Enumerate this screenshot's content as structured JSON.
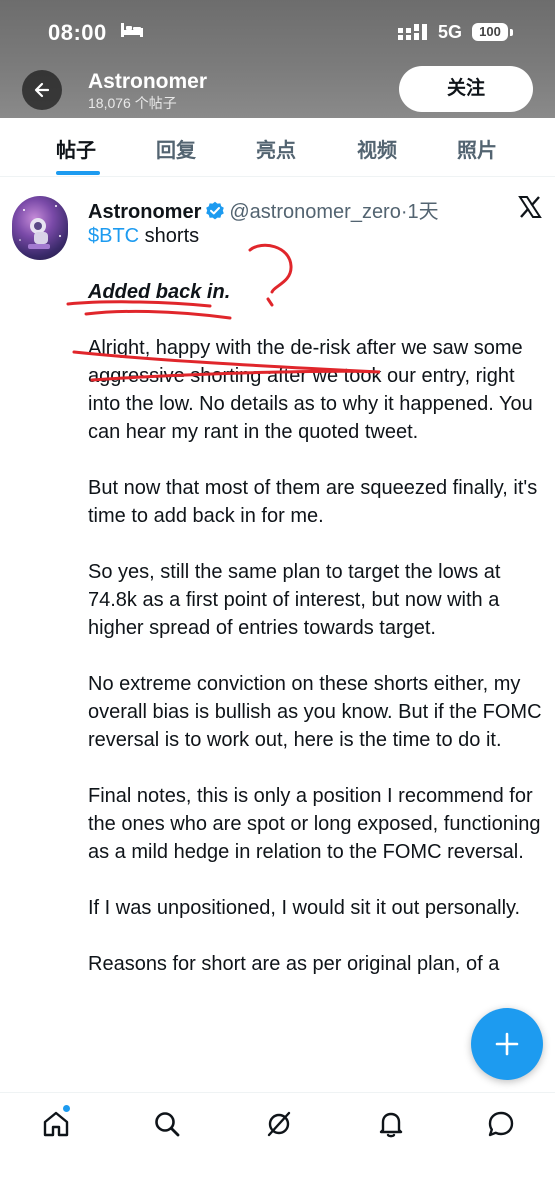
{
  "status_bar": {
    "time": "08:00",
    "network": "5G",
    "battery": "100"
  },
  "header": {
    "name": "Astronomer",
    "post_count": "18,076 个帖子",
    "follow_label": "关注"
  },
  "tabs": [
    {
      "label": "帖子",
      "active": true
    },
    {
      "label": "回复",
      "active": false
    },
    {
      "label": "亮点",
      "active": false
    },
    {
      "label": "视频",
      "active": false
    },
    {
      "label": "照片",
      "active": false
    }
  ],
  "post": {
    "author_name": "Astronomer",
    "author_handle": "@astronomer_zero",
    "time_ago": "·1天",
    "cashtag": "$BTC",
    "title_rest": " shorts",
    "added_line": "Added back in.",
    "paragraphs": [
      "Alright, happy with the de-risk after we saw some aggressive shorting after we took our entry, right into the low. No details as to why it happened. You can hear my rant in the quoted tweet.",
      "But now that most of them are squeezed finally, it's time to add back in for me.",
      "So yes, still the same plan to target the lows at 74.8k as a first point of interest, but now with a higher spread of entries towards target.",
      "No extreme conviction on these shorts either, my overall bias is bullish as you know. But if the FOMC reversal is to work out, here is the time to do it.",
      "Final notes, this is only a position I recommend for the ones who are spot or long exposed, functioning as a mild hedge in relation to the FOMC reversal.",
      "If I was unpositioned, I would sit it out personally.",
      "Reasons for short are as per original plan, of a"
    ]
  },
  "colors": {
    "accent": "#1d9bf0",
    "header_bg": "#777777",
    "annotation_red": "#e0262b"
  },
  "icons": {
    "back": "arrow-left-icon",
    "verified": "verified-badge-icon",
    "platform": "x-logo-icon",
    "compose": "plus-icon",
    "nav": [
      "home-icon",
      "search-icon",
      "grok-icon",
      "bell-icon",
      "messages-icon"
    ]
  }
}
